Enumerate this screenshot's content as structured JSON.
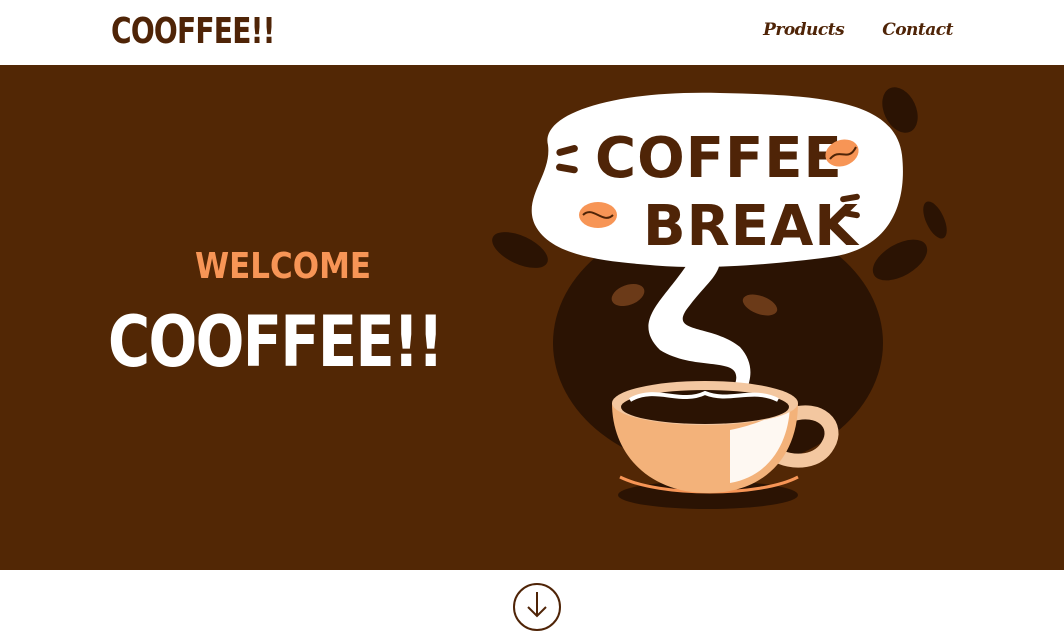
{
  "header": {
    "logo": "COOFFEE!!",
    "nav": [
      {
        "label": "Products"
      },
      {
        "label": "Contact"
      }
    ]
  },
  "hero": {
    "welcome": "WELCOME",
    "title": "COOFFEE!!",
    "illustration": {
      "line1": "COFFEE",
      "line2": "BREAK"
    }
  },
  "scroll": {
    "icon": "arrow-down-circle-icon"
  },
  "colors": {
    "brown_dark": "#522705",
    "brown_text": "#4f2407",
    "orange": "#f79556",
    "white": "#ffffff"
  }
}
